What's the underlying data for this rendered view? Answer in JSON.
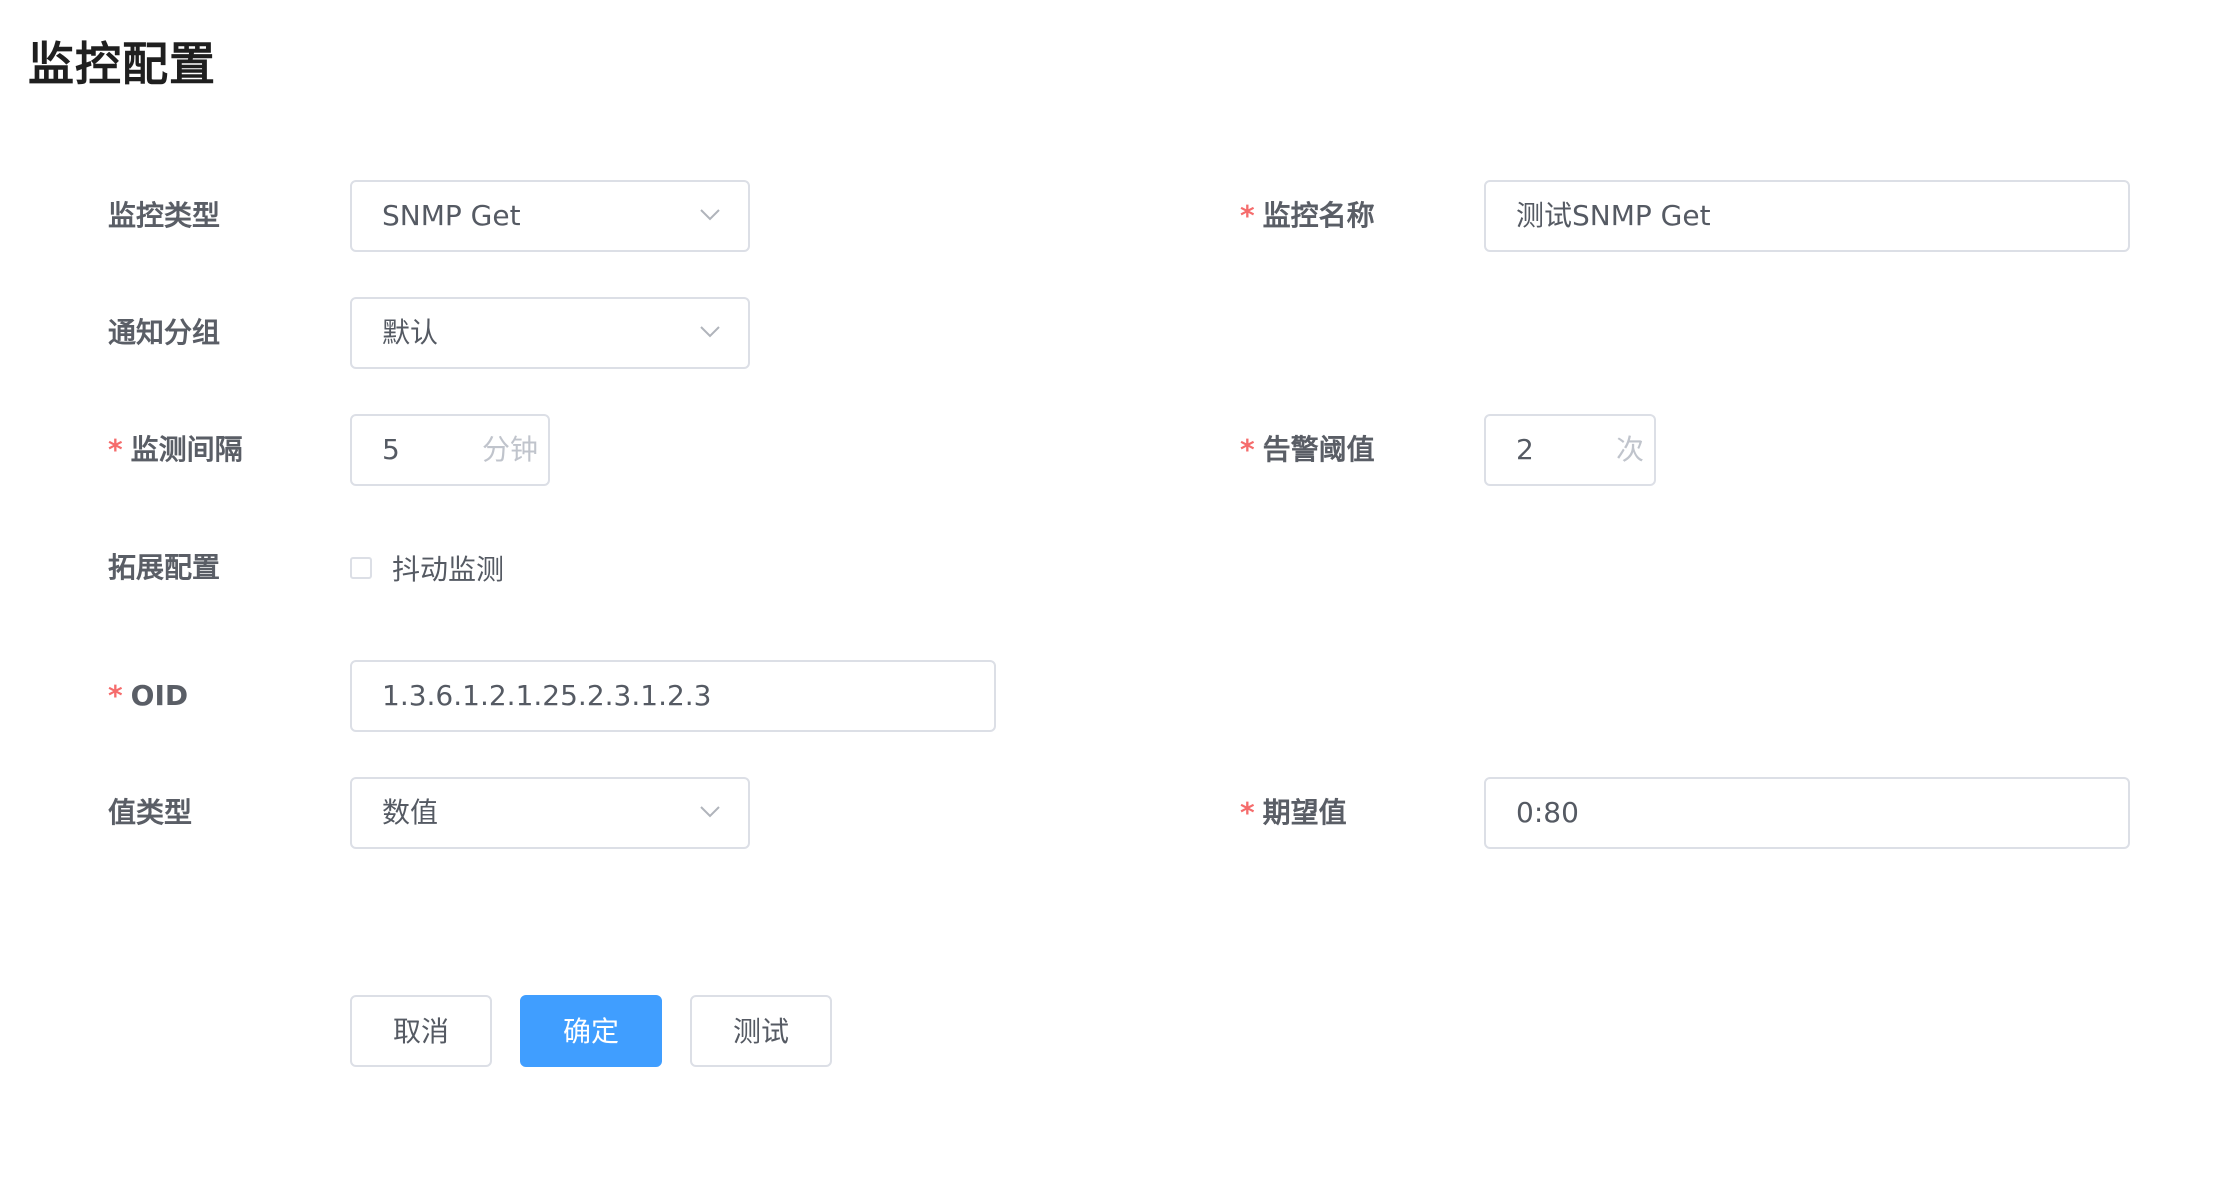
{
  "page": {
    "title": "监控配置"
  },
  "form": {
    "monitor_type": {
      "label": "监控类型",
      "required": false,
      "value": "SNMP Get"
    },
    "monitor_name": {
      "label": "监控名称",
      "required": true,
      "value": "测试SNMP Get"
    },
    "notify_group": {
      "label": "通知分组",
      "required": false,
      "value": "默认"
    },
    "check_interval": {
      "label": "监测间隔",
      "required": true,
      "value": "5",
      "suffix": "分钟"
    },
    "alert_threshold": {
      "label": "告警阈值",
      "required": true,
      "value": "2",
      "suffix": "次"
    },
    "extension": {
      "label": "拓展配置",
      "checkbox_label": "抖动监测",
      "checked": false
    },
    "oid": {
      "label": "OID",
      "required": true,
      "value": "1.3.6.1.2.1.25.2.3.1.2.3"
    },
    "value_type": {
      "label": "值类型",
      "required": false,
      "value": "数值"
    },
    "expected_value": {
      "label": "期望值",
      "required": true,
      "value": "0:80"
    },
    "required_mark": "*"
  },
  "buttons": {
    "cancel": "取消",
    "confirm": "确定",
    "test": "测试"
  },
  "colors": {
    "primary": "#409eff",
    "required": "#f56c6c",
    "border": "#dcdfe6"
  },
  "icons": {
    "select_arrow": "chevron-down-icon"
  }
}
